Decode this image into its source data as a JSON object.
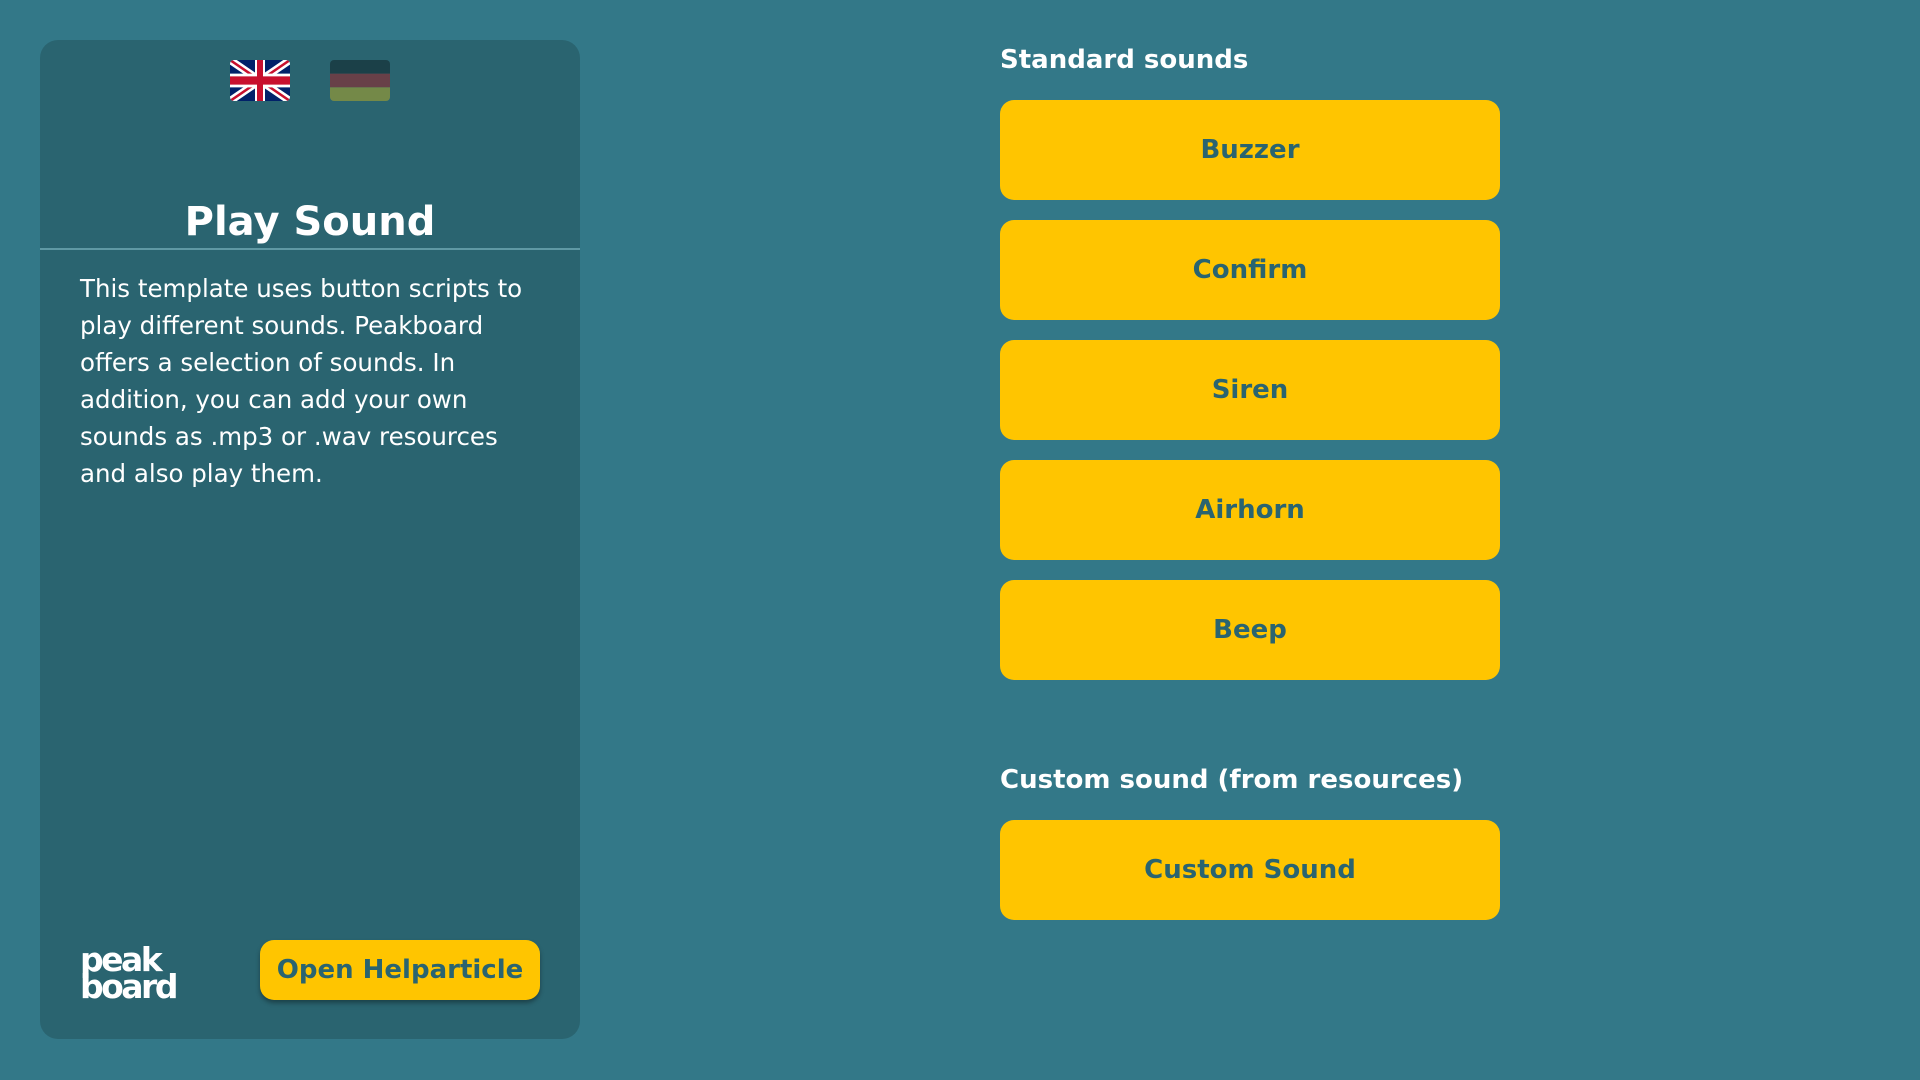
{
  "colors": {
    "background": "#337888",
    "panel": "#2a6470",
    "accent": "#ffc500",
    "button_text": "#2a6470",
    "text": "#ffffff"
  },
  "language_switch": {
    "options": [
      {
        "icon": "flag-uk-icon",
        "selected": true
      },
      {
        "icon": "flag-de-icon",
        "selected": false
      }
    ]
  },
  "info_panel": {
    "title": "Play Sound",
    "description": "This template uses button scripts to play different sounds. Peakboard offers a selection of sounds. In addition, you can add your own sounds as .mp3 or .wav resources and also play them.",
    "logo": {
      "line1": "peak",
      "line2": "board"
    },
    "help_button_label": "Open Helparticle"
  },
  "standard_sounds": {
    "heading": "Standard sounds",
    "buttons": [
      {
        "label": "Buzzer"
      },
      {
        "label": "Confirm"
      },
      {
        "label": "Siren"
      },
      {
        "label": "Airhorn"
      },
      {
        "label": "Beep"
      }
    ]
  },
  "custom_sounds": {
    "heading": "Custom sound (from resources)",
    "button_label": "Custom Sound"
  }
}
